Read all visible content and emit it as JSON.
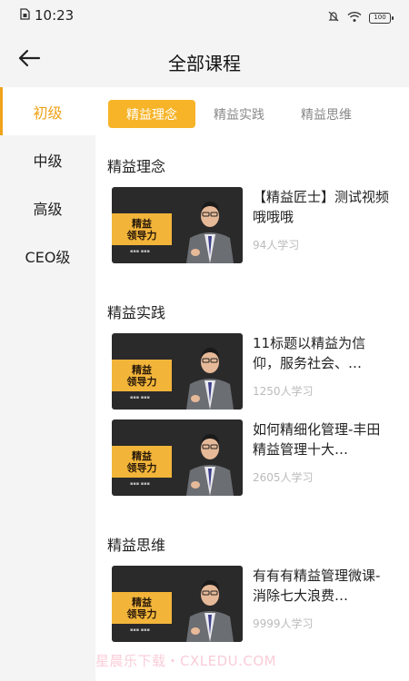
{
  "status_bar": {
    "time": "10:23",
    "battery": "100"
  },
  "header": {
    "title": "全部课程",
    "back_icon": "arrow-left-icon"
  },
  "sidebar": {
    "items": [
      {
        "label": "初级",
        "active": true
      },
      {
        "label": "中级",
        "active": false
      },
      {
        "label": "高级",
        "active": false
      },
      {
        "label": "CEO级",
        "active": false
      }
    ]
  },
  "tabs": [
    {
      "label": "精益理念",
      "active": true
    },
    {
      "label": "精益实践",
      "active": false
    },
    {
      "label": "精益思维",
      "active": false
    }
  ],
  "sections": [
    {
      "title": "精益理念",
      "courses": [
        {
          "title": "【精益匠士】测试视频哦哦哦",
          "learners": "94人学习",
          "thumb_text_1": "精益",
          "thumb_text_2": "领导力"
        }
      ]
    },
    {
      "title": "精益实践",
      "courses": [
        {
          "title": "11标题以精益为信仰，服务社会、…",
          "learners": "1250人学习",
          "thumb_text_1": "精益",
          "thumb_text_2": "领导力"
        },
        {
          "title": "如何精细化管理-丰田精益管理十大…",
          "learners": "2605人学习",
          "thumb_text_1": "精益",
          "thumb_text_2": "领导力"
        }
      ]
    },
    {
      "title": "精益思维",
      "courses": [
        {
          "title": "有有有精益管理微课-消除七大浪费…",
          "learners": "9999人学习",
          "thumb_text_1": "精益",
          "thumb_text_2": "领导力"
        }
      ]
    }
  ],
  "watermark": "星晨乐下载・CXLEDU.COM",
  "colors": {
    "accent": "#f0a21b",
    "tab_active_bg": "#f7b428",
    "background": "#f4f4f4"
  }
}
